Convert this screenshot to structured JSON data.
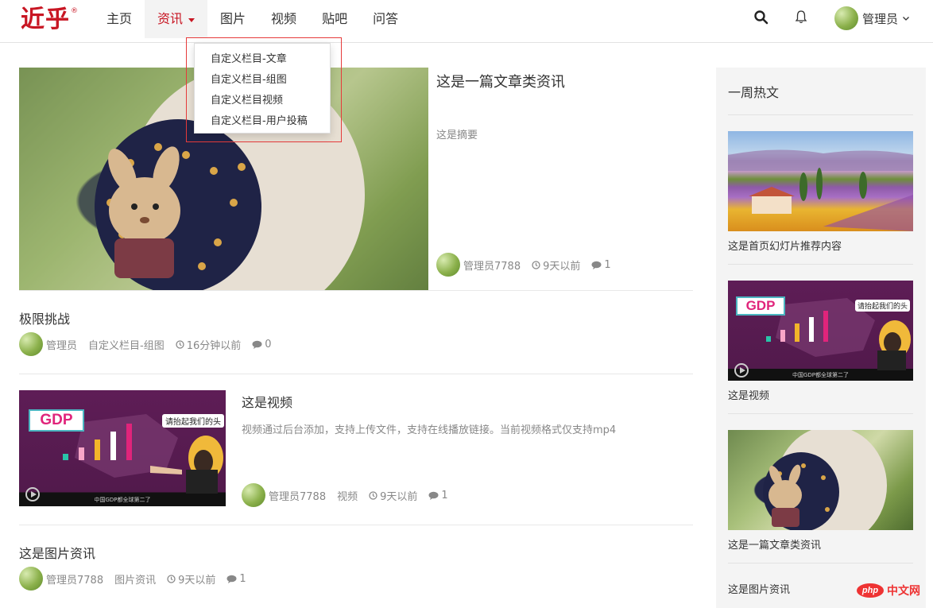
{
  "brand": {
    "logo_text": "近乎",
    "logo_mark": "®"
  },
  "nav": {
    "items": [
      {
        "label": "主页",
        "active": false
      },
      {
        "label": "资讯",
        "active": true,
        "has_dropdown": true
      },
      {
        "label": "图片",
        "active": false
      },
      {
        "label": "视频",
        "active": false
      },
      {
        "label": "贴吧",
        "active": false
      },
      {
        "label": "问答",
        "active": false
      }
    ],
    "dropdown": [
      "自定义栏目-文章",
      "自定义栏目-组图",
      "自定义栏目视频",
      "自定义栏目-用户投稿"
    ]
  },
  "header": {
    "user_name": "管理员",
    "icons": [
      "search-icon",
      "bell-icon",
      "chevron-down-icon"
    ]
  },
  "feed": [
    {
      "title": "这是一篇文章类资讯",
      "summary": "这是摘要",
      "author": "管理员7788",
      "time": "9天以前",
      "comments": "1",
      "image": "child-with-bunny-backpack"
    },
    {
      "title": "极限挑战",
      "author": "管理员",
      "category": "自定义栏目-组图",
      "time": "16分钟以前",
      "comments": "0"
    },
    {
      "title": "这是视频",
      "summary": "视频通过后台添加，支持上传文件，支持在线播放链接。当前视频格式仅支持mp4",
      "author": "管理员7788",
      "category": "视频",
      "time": "9天以前",
      "comments": "1",
      "image": "gdp-video-thumbnail"
    },
    {
      "title": "这是图片资讯",
      "author": "管理员7788",
      "category": "图片资讯",
      "time": "9天以前",
      "comments": "1"
    }
  ],
  "thumb_text": {
    "gdp": "GDP",
    "bubble": "请抬起我们的头",
    "caption": "中国GDP都全球第二了"
  },
  "sidebar": {
    "title": "一周热文",
    "items": [
      {
        "caption": "这是首页幻灯片推荐内容"
      },
      {
        "caption": "这是视频"
      },
      {
        "caption": "这是一篇文章类资讯"
      },
      {
        "caption": "这是图片资讯"
      }
    ]
  },
  "watermark": {
    "php": "php",
    "cn": "中文网"
  },
  "colors": {
    "accent": "#c81623",
    "muted": "#888888",
    "sidebar_bg": "#f4f4f4"
  }
}
